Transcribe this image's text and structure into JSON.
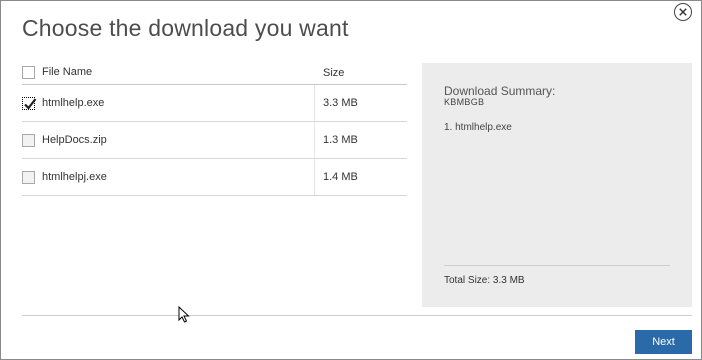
{
  "dialog": {
    "title": "Choose the download you want",
    "close_icon": "close-circle-icon"
  },
  "table": {
    "headers": {
      "name": "File Name",
      "size": "Size"
    },
    "select_all_checked": false,
    "rows": [
      {
        "name": "htmlhelp.exe",
        "size": "3.3 MB",
        "checked": true
      },
      {
        "name": "HelpDocs.zip",
        "size": "1.3 MB",
        "checked": false
      },
      {
        "name": "htmlhelpj.exe",
        "size": "1.4 MB",
        "checked": false
      }
    ]
  },
  "summary": {
    "title": "Download Summary:",
    "code": "KBMBGB",
    "items": [
      "1. htmlhelp.exe"
    ],
    "total": "Total Size: 3.3 MB"
  },
  "footer": {
    "next_label": "Next"
  },
  "colors": {
    "accent": "#2b6aa8",
    "summary_bg": "#ececec"
  }
}
